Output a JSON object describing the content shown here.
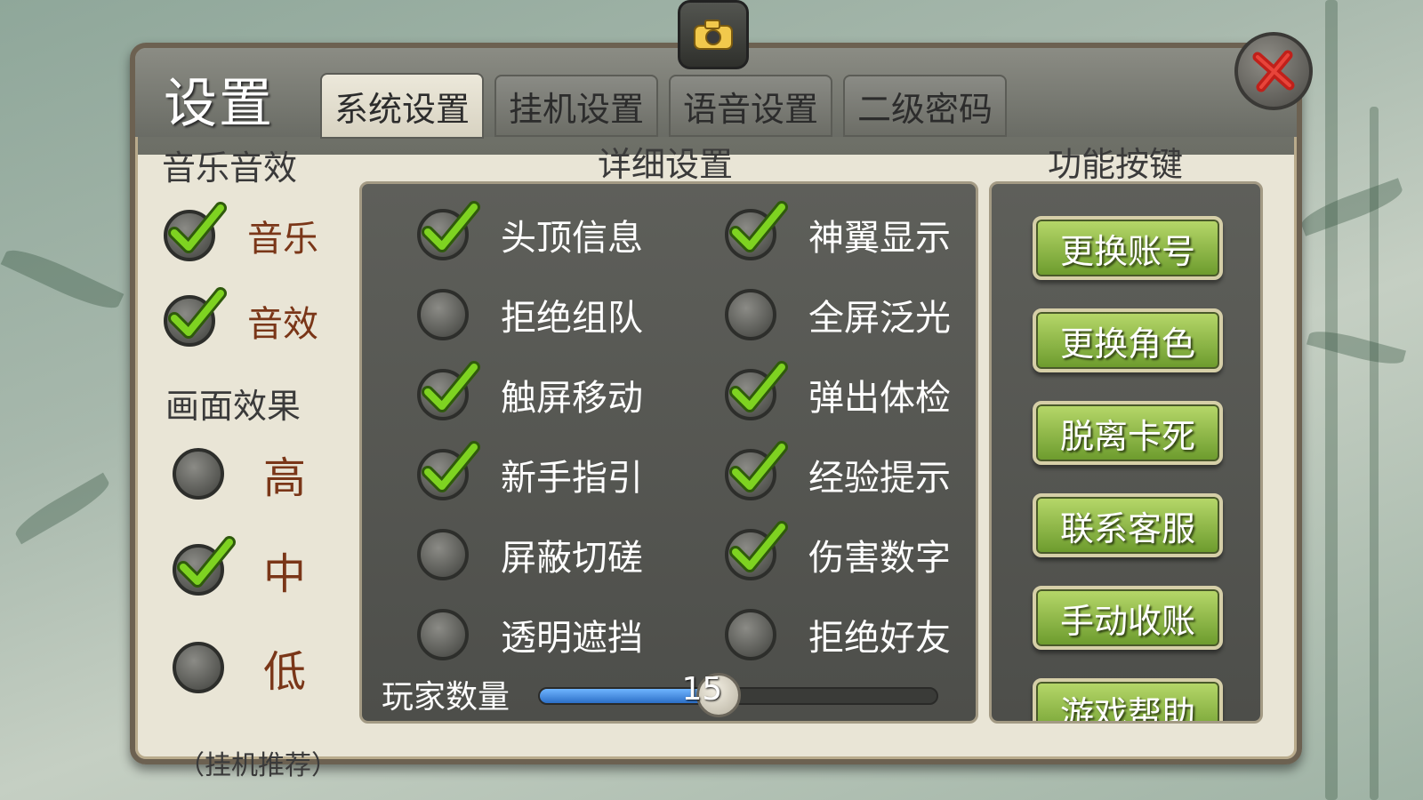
{
  "window": {
    "title": "设置"
  },
  "tabs": [
    {
      "label": "系统设置",
      "active": true
    },
    {
      "label": "挂机设置",
      "active": false
    },
    {
      "label": "语音设置",
      "active": false
    },
    {
      "label": "二级密码",
      "active": false
    }
  ],
  "icons": {
    "camera": "camera-icon",
    "close": "close-icon"
  },
  "sections": {
    "audio": {
      "title": "音乐音效",
      "items": [
        {
          "label": "音乐",
          "checked": true
        },
        {
          "label": "音效",
          "checked": true
        }
      ]
    },
    "graphics": {
      "title": "画面效果",
      "items": [
        {
          "label": "高",
          "checked": false
        },
        {
          "label": "中",
          "checked": true
        },
        {
          "label": "低",
          "checked": false
        }
      ],
      "note": "（挂机推荐）"
    },
    "detail": {
      "title": "详细设置",
      "options": [
        {
          "label": "头顶信息",
          "checked": true
        },
        {
          "label": "神翼显示",
          "checked": true
        },
        {
          "label": "拒绝组队",
          "checked": false
        },
        {
          "label": "全屏泛光",
          "checked": false
        },
        {
          "label": "触屏移动",
          "checked": true
        },
        {
          "label": "弹出体检",
          "checked": true
        },
        {
          "label": "新手指引",
          "checked": true
        },
        {
          "label": "经验提示",
          "checked": true
        },
        {
          "label": "屏蔽切磋",
          "checked": false
        },
        {
          "label": "伤害数字",
          "checked": true
        },
        {
          "label": "透明遮挡",
          "checked": false
        },
        {
          "label": "拒绝好友",
          "checked": false
        }
      ],
      "slider": {
        "label": "玩家数量",
        "value": "15",
        "fill_fraction": 0.45
      }
    },
    "functions": {
      "title": "功能按键",
      "buttons": [
        "更换账号",
        "更换角色",
        "脱离卡死",
        "联系客服",
        "手动收账",
        "游戏帮助"
      ]
    }
  },
  "colors": {
    "check": "#7ed321",
    "button_green": "#8fbf43",
    "label_brown": "#7a3618",
    "slider_fill": "#3b82d6"
  }
}
